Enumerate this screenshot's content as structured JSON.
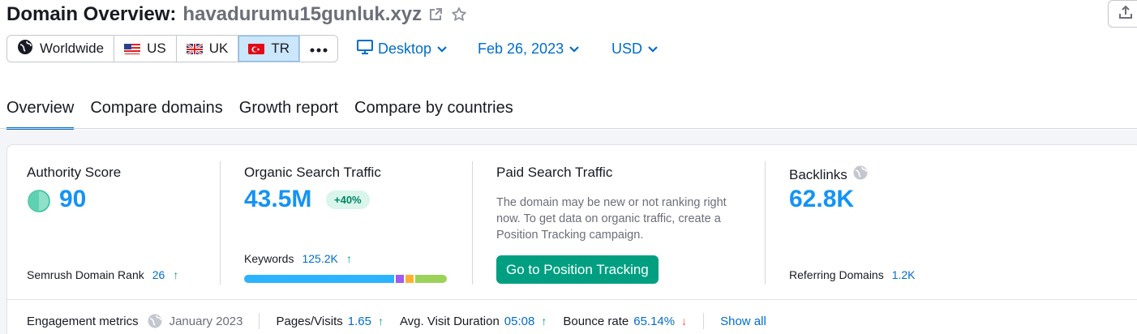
{
  "header": {
    "title_prefix": "Domain Overview:",
    "domain": "havadurumu15gunluk.xyz"
  },
  "regions": [
    {
      "label": "Worldwide",
      "active": false
    },
    {
      "label": "US",
      "active": false
    },
    {
      "label": "UK",
      "active": false
    },
    {
      "label": "TR",
      "active": true
    }
  ],
  "filters": {
    "device": "Desktop",
    "date": "Feb 26, 2023",
    "currency": "USD"
  },
  "tabs": [
    {
      "label": "Overview",
      "active": true
    },
    {
      "label": "Compare domains",
      "active": false
    },
    {
      "label": "Growth report",
      "active": false
    },
    {
      "label": "Compare by countries",
      "active": false
    }
  ],
  "authority": {
    "title": "Authority Score",
    "value": "90",
    "rank_label": "Semrush Domain Rank",
    "rank_value": "26"
  },
  "organic": {
    "title": "Organic Search Traffic",
    "value": "43.5M",
    "change": "+40%",
    "keywords_label": "Keywords",
    "keywords_value": "125.2K",
    "bar_segments": [
      {
        "share": 0.76,
        "color": "#2bb3ff"
      },
      {
        "share": 0.04,
        "color": "#a15bf0"
      },
      {
        "share": 0.04,
        "color": "#ffb030"
      },
      {
        "share": 0.16,
        "color": "#9bd35a"
      }
    ]
  },
  "paid": {
    "title": "Paid Search Traffic",
    "description": "The domain may be new or not ranking right now. To get data on organic traffic, create a Position Tracking campaign.",
    "cta": "Go to Position Tracking"
  },
  "backlinks": {
    "title": "Backlinks",
    "value": "62.8K",
    "ref_label": "Referring Domains",
    "ref_value": "1.2K"
  },
  "engagement": {
    "label": "Engagement metrics",
    "period": "January 2023",
    "pages_label": "Pages/Visits",
    "pages_value": "1.65",
    "duration_label": "Avg. Visit Duration",
    "duration_value": "05:08",
    "bounce_label": "Bounce rate",
    "bounce_value": "65.14%",
    "show_all": "Show all"
  },
  "colors": {
    "accent": "#006dca",
    "big_number": "#1493f5",
    "cta": "#009f81",
    "active_region_bg": "#cce6fb"
  }
}
